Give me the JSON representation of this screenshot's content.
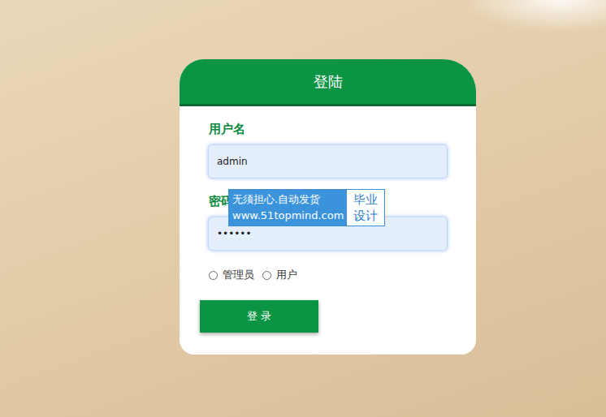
{
  "title": "登陆",
  "fields": [
    {
      "label": "用户名",
      "value": "admin",
      "kind": "text"
    },
    {
      "label": "密码",
      "value": "••••••",
      "kind": "password"
    }
  ],
  "roles": [
    {
      "label": "管理员",
      "selected": false
    },
    {
      "label": "用户",
      "selected": false
    }
  ],
  "button": "登 录",
  "watermark": {
    "lines": [
      "无须担心.自动发货",
      "www.51topmind.com"
    ],
    "badge": "毕业设计"
  }
}
